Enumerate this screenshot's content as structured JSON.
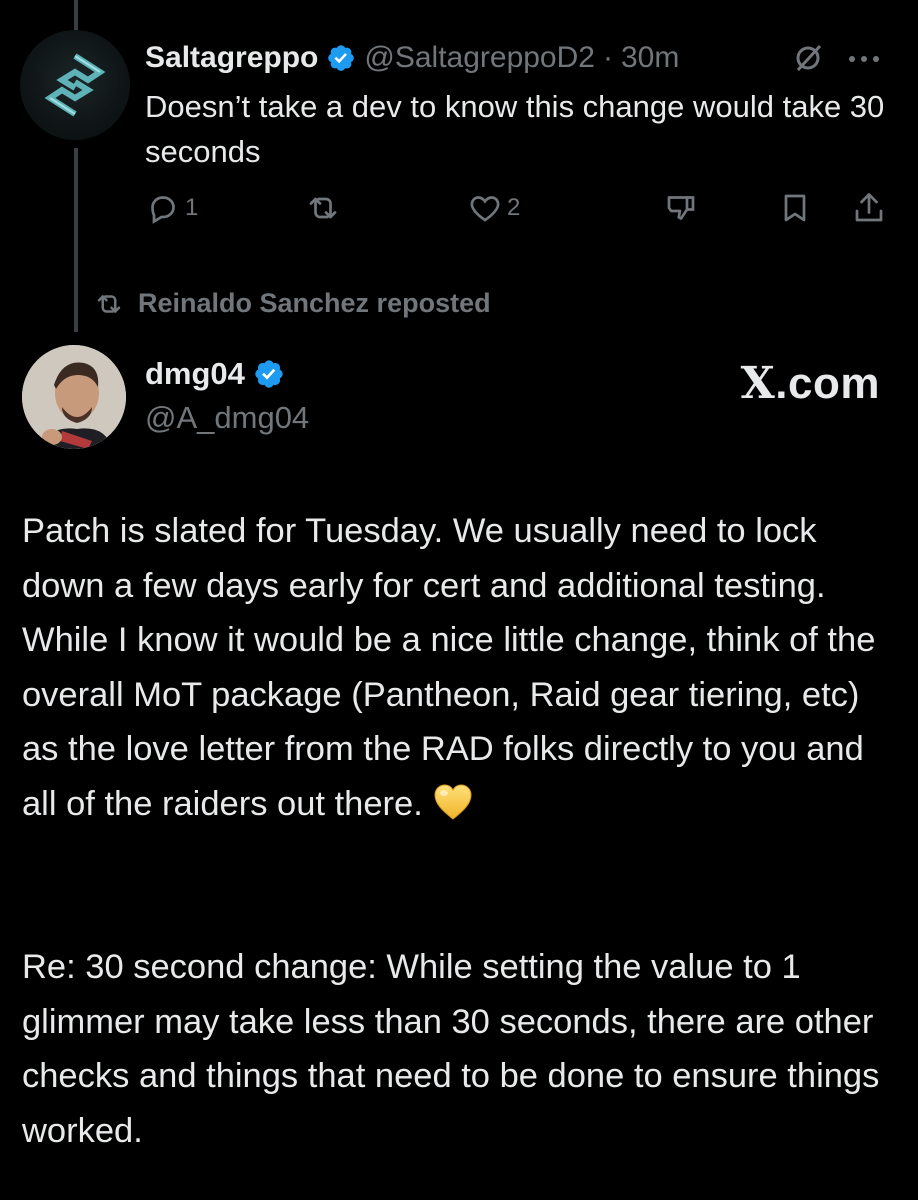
{
  "first_tweet": {
    "name": "Saltagreppo",
    "handle": "@SaltagreppoD2",
    "separator": "·",
    "time": "30m",
    "text": "Doesn’t take a dev to know this change would take 30 seconds",
    "reply_count": "1",
    "like_count": "2"
  },
  "repost_banner": {
    "text": "Reinaldo Sanchez reposted"
  },
  "second_tweet": {
    "name": "dmg04",
    "handle": "@A_dmg04",
    "watermark_x": "X",
    "watermark_rest": ".com",
    "paragraph1": "Patch is slated for Tuesday. We usually need to lock down a few days early for cert and additional testing. While I know it would be a nice little change, think of the overall MoT package (Pantheon, Raid gear tiering, etc) as the love letter from the RAD folks directly to you and all of the raiders out there.",
    "paragraph2": "Re: 30 second change: While setting the value to 1 glimmer may take less than 30 seconds, there are other checks and things that need to be done to ensure things worked."
  },
  "colors": {
    "background": "#000000",
    "text": "#e7e9ea",
    "muted": "#71767b",
    "verified": "#1d9bf0",
    "heart_emoji": "#f7c948"
  },
  "icons": [
    "verified-badge-icon",
    "grok-icon",
    "more-icon",
    "reply-icon",
    "repost-icon",
    "like-icon",
    "dislike-icon",
    "bookmark-icon",
    "share-icon",
    "yellow-heart-emoji"
  ]
}
